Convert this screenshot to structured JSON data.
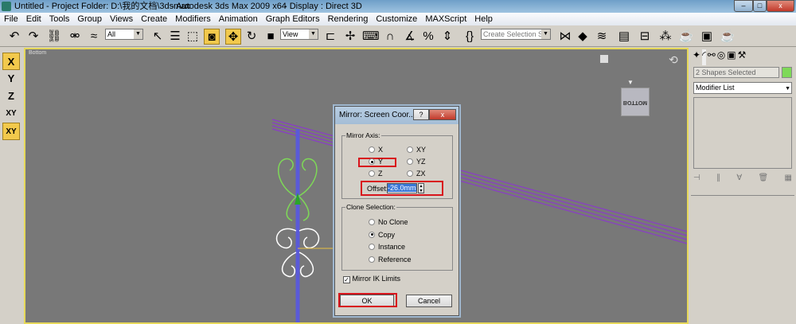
{
  "title_bar": {
    "doc": "Untitled",
    "project": "- Project Folder: D:\\我的文档\\3dsmax",
    "app": "- Autodesk 3ds Max  2009 x64",
    "display": "- Display : Direct 3D",
    "minimize": "–",
    "maximize": "□",
    "close": "x"
  },
  "menu": [
    "File",
    "Edit",
    "Tools",
    "Group",
    "Views",
    "Create",
    "Modifiers",
    "Animation",
    "Graph Editors",
    "Rendering",
    "Customize",
    "MAXScript",
    "Help"
  ],
  "toolbar": {
    "selection_filter": "All",
    "ref_coord": "View",
    "selection_set_placeholder": "Create Selection Set",
    "icons": [
      "undo-icon",
      "redo-icon",
      "select-link-icon",
      "unlink-icon",
      "bind-space-warp-icon",
      "select-icon",
      "select-by-name-icon",
      "rect-region-icon",
      "window-crossing-icon",
      "move-icon",
      "rotate-icon",
      "scale-icon",
      "pivot-icon",
      "manipulate-icon",
      "keyboard-shortcut-icon",
      "snap-icon",
      "angle-snap-icon",
      "percent-snap-icon",
      "spinner-snap-icon",
      "named-sets-icon",
      "mirror-icon",
      "align-icon",
      "layers-icon",
      "curve-editor-icon",
      "schematic-icon",
      "material-editor-icon",
      "render-setup-icon",
      "rendered-frame-icon",
      "quick-render-icon"
    ]
  },
  "axis_constraints": [
    "X",
    "Y",
    "Z",
    "XY",
    "XY"
  ],
  "viewport": {
    "label": "Bottom",
    "viewcube_label": "BOTTOM"
  },
  "command_panel": {
    "selection_info": "2 Shapes Selected",
    "modifier_list": "Modifier List",
    "object_color": "#7ed957"
  },
  "dialog": {
    "title": "Mirror: Screen Coor...",
    "help": "?",
    "close": "x",
    "mirror_axis_label": "Mirror Axis:",
    "axes": [
      {
        "label": "X",
        "selected": false
      },
      {
        "label": "Y",
        "selected": true
      },
      {
        "label": "Z",
        "selected": false
      },
      {
        "label": "XY",
        "selected": false
      },
      {
        "label": "YZ",
        "selected": false
      },
      {
        "label": "ZX",
        "selected": false
      }
    ],
    "offset_label": "Offset:",
    "offset_value": "-26.0mm",
    "clone_label": "Clone Selection:",
    "clone_options": [
      {
        "label": "No Clone",
        "selected": false
      },
      {
        "label": "Copy",
        "selected": true
      },
      {
        "label": "Instance",
        "selected": false
      },
      {
        "label": "Reference",
        "selected": false
      }
    ],
    "mirror_ik_label": "Mirror IK Limits",
    "mirror_ik_checked": true,
    "ok": "OK",
    "cancel": "Cancel"
  },
  "colors": {
    "highlight": "#d8141c",
    "active_tool": "#f2c94c",
    "viewport_bg": "#787878",
    "shape_purple": "#8a3cc8",
    "shape_green": "#7ed957"
  }
}
